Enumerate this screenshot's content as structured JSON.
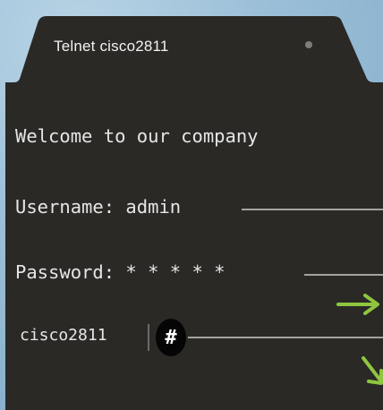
{
  "tab": {
    "title": "Telnet cisco2811"
  },
  "terminal": {
    "welcome": "Welcome to our company",
    "username_line": "Username: admin",
    "password_line": "Password: * * * * *",
    "prompt_host": "cisco2811",
    "prompt_symbol": "#"
  },
  "colors": {
    "terminal_bg": "#2a2926",
    "terminal_text": "#e6e6e6",
    "arrow_accent": "#8ec63f",
    "background": "#8fb5cf"
  },
  "icons": {
    "tab_status": "dot-icon",
    "annotation": "arrow-icon"
  }
}
